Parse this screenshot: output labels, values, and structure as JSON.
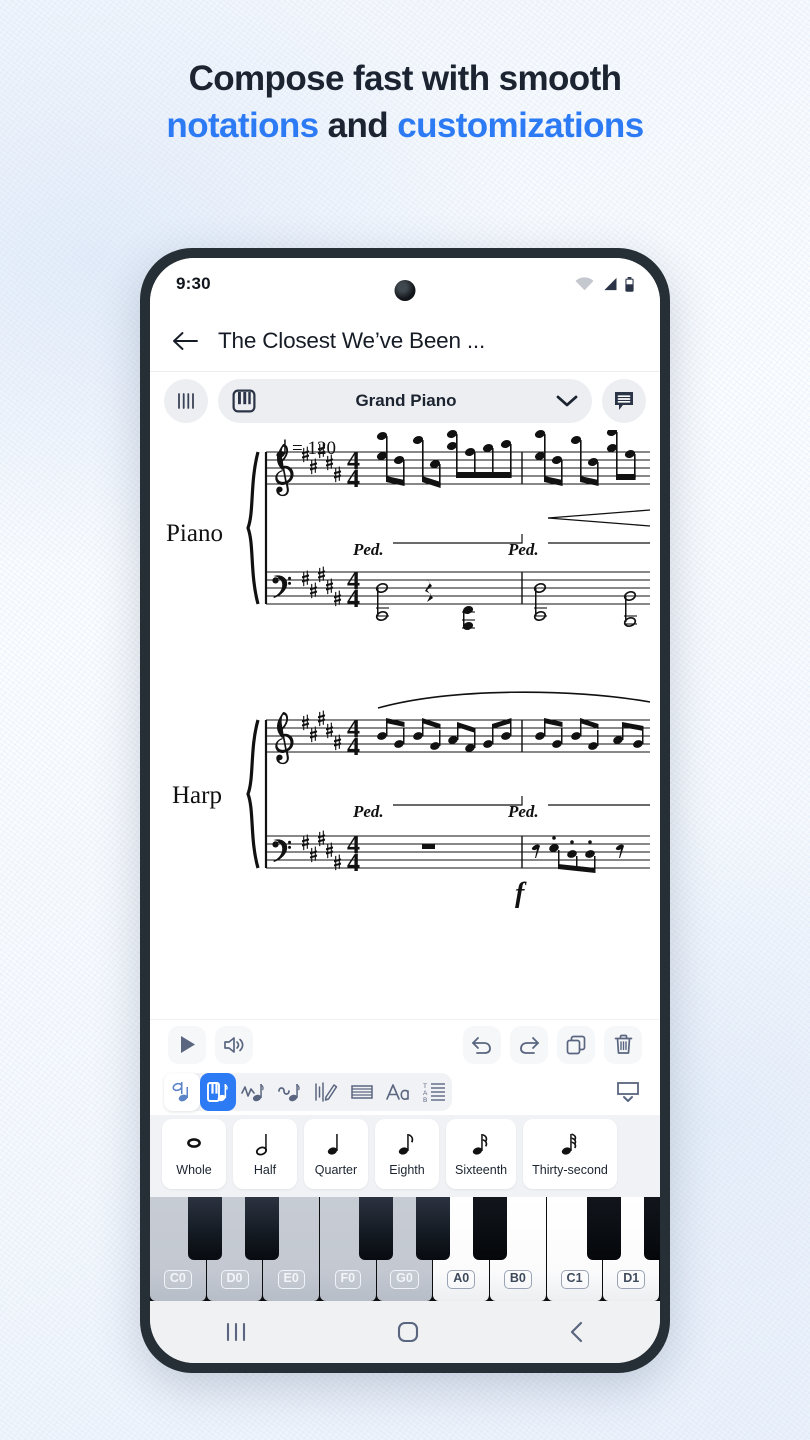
{
  "headline": {
    "line1": "Compose fast with smooth",
    "line2_a": "notations",
    "line2_b": " and ",
    "line2_c": "customizations",
    "accent_color": "#2d7bf4"
  },
  "phone": {
    "statusbar": {
      "time": "9:30",
      "icons": [
        "wifi-icon",
        "cellular-signal-icon",
        "battery-icon"
      ]
    },
    "appbar": {
      "back_icon": "back-arrow-icon",
      "title": "The Closest We’ve Been ..."
    },
    "instrument_bar": {
      "staff_lines_icon": "staff-lines-icon",
      "piano_icon": "piano-keys-icon",
      "instrument_name": "Grand Piano",
      "chevron_icon": "chevron-down-icon",
      "comments_icon": "comment-bubble-icon"
    },
    "score": {
      "tempo_note": "quarter-note",
      "tempo_text": "= 120",
      "systems": [
        {
          "label": "Piano",
          "clefs": [
            "treble",
            "bass"
          ],
          "key_signature_sharps": 5,
          "time_signature": "4/4",
          "pedal_marks": [
            "Ped.",
            "Ped."
          ],
          "has_crescendo": true
        },
        {
          "label": "Harp",
          "clefs": [
            "treble",
            "bass"
          ],
          "key_signature_sharps": 5,
          "time_signature": "4/4",
          "pedal_marks": [
            "Ped.",
            "Ped."
          ],
          "has_slur": true,
          "dynamic": "f"
        }
      ]
    },
    "playback_toolbar": {
      "left": [
        {
          "name": "play-button",
          "icon": "play-icon"
        },
        {
          "name": "volume-button",
          "icon": "volume-icon"
        }
      ],
      "right": [
        {
          "name": "undo-button",
          "icon": "undo-icon"
        },
        {
          "name": "redo-button",
          "icon": "redo-icon"
        },
        {
          "name": "copy-button",
          "icon": "copy-icon"
        },
        {
          "name": "delete-button",
          "icon": "trash-icon"
        }
      ]
    },
    "tools_row": {
      "tools": [
        {
          "name": "tool-note-input",
          "icon": "half-note-icon",
          "state": "white"
        },
        {
          "name": "tool-keyboard-notes",
          "icon": "piano-note-icon",
          "state": "active"
        },
        {
          "name": "tool-articulations",
          "icon": "articulation-note-icon",
          "state": "normal"
        },
        {
          "name": "tool-ornaments",
          "icon": "ornament-note-icon",
          "state": "normal"
        },
        {
          "name": "tool-dynamics",
          "icon": "dynamics-pencil-icon",
          "state": "normal"
        },
        {
          "name": "tool-staff",
          "icon": "staff-grid-icon",
          "state": "normal"
        },
        {
          "name": "tool-text",
          "icon": "text-aa-icon",
          "state": "normal"
        },
        {
          "name": "tool-tab",
          "icon": "tab-lines-icon",
          "state": "normal"
        }
      ],
      "hide_keyboard_icon": "hide-keyboard-icon"
    },
    "durations": [
      {
        "label": "Whole",
        "icon": "whole-note-icon"
      },
      {
        "label": "Half",
        "icon": "half-note-icon"
      },
      {
        "label": "Quarter",
        "icon": "quarter-note-icon"
      },
      {
        "label": "Eighth",
        "icon": "eighth-note-icon"
      },
      {
        "label": "Sixteenth",
        "icon": "sixteenth-note-icon"
      },
      {
        "label": "Thirty-second",
        "icon": "thirty-second-note-icon"
      }
    ],
    "keyboard": {
      "white_keys": [
        {
          "label": "C0",
          "state": "dim"
        },
        {
          "label": "D0",
          "state": "dim"
        },
        {
          "label": "E0",
          "state": "dim"
        },
        {
          "label": "F0",
          "state": "dim"
        },
        {
          "label": "G0",
          "state": "dim"
        },
        {
          "label": "A0",
          "state": "plain"
        },
        {
          "label": "B0",
          "state": "plain"
        },
        {
          "label": "C1",
          "state": "plain"
        },
        {
          "label": "D1",
          "state": "plain"
        }
      ]
    },
    "navbar": [
      {
        "name": "nav-recents-button",
        "icon": "recents-icon"
      },
      {
        "name": "nav-home-button",
        "icon": "home-icon"
      },
      {
        "name": "nav-back-button",
        "icon": "back-chevron-icon"
      }
    ]
  }
}
